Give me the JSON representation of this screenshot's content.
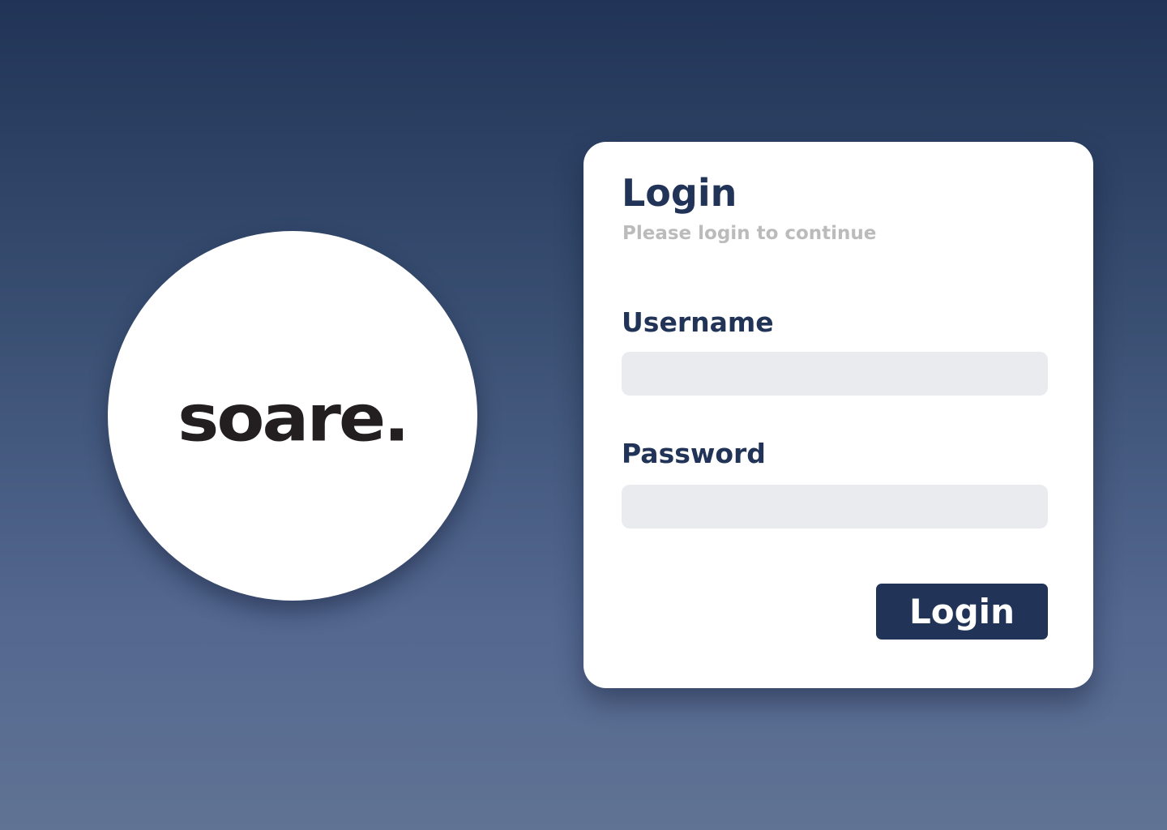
{
  "logo": {
    "text": "soare.",
    "name": "soare-logo"
  },
  "login_card": {
    "title": "Login",
    "subtitle": "Please login to continue",
    "username": {
      "label": "Username",
      "value": "",
      "placeholder": ""
    },
    "password": {
      "label": "Password",
      "value": "",
      "placeholder": ""
    },
    "submit_label": "Login"
  },
  "colors": {
    "brand_navy": "#213457",
    "input_background": "#e9ebef",
    "subtitle_gray": "#bbbbbb",
    "card_background": "#ffffff",
    "logo_text": "#231f20"
  }
}
